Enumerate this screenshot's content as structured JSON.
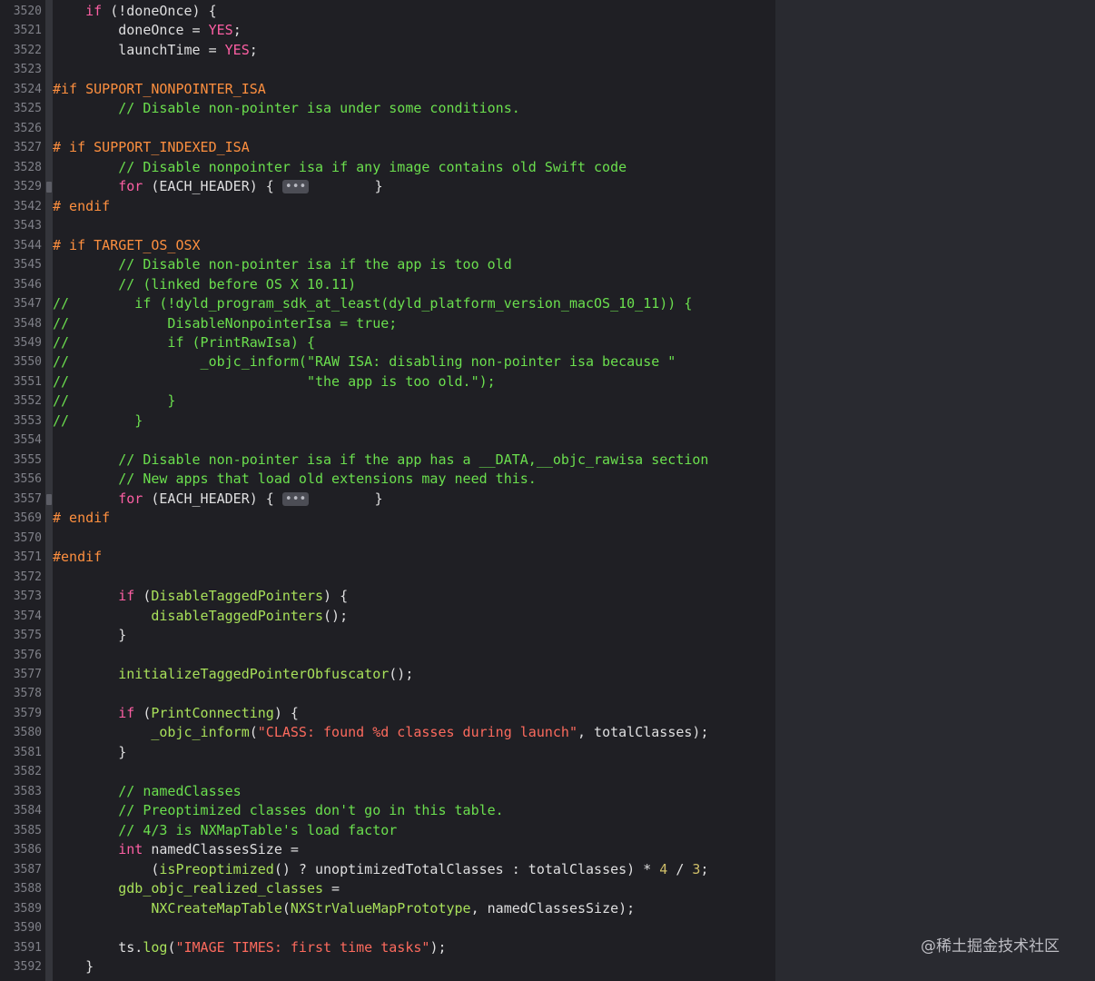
{
  "editor": {
    "lines": [
      {
        "n": "3520",
        "segs": [
          [
            "id",
            "    "
          ],
          [
            "kw",
            "if"
          ],
          [
            "id",
            " (!doneOnce) {"
          ]
        ]
      },
      {
        "n": "3521",
        "segs": [
          [
            "id",
            "        doneOnce = "
          ],
          [
            "kw",
            "YES"
          ],
          [
            "id",
            ";"
          ]
        ]
      },
      {
        "n": "3522",
        "segs": [
          [
            "id",
            "        launchTime = "
          ],
          [
            "kw",
            "YES"
          ],
          [
            "id",
            ";"
          ]
        ]
      },
      {
        "n": "3523",
        "segs": []
      },
      {
        "n": "3524",
        "segs": [
          [
            "pp",
            "#if SUPPORT_NONPOINTER_ISA"
          ]
        ]
      },
      {
        "n": "3525",
        "segs": [
          [
            "cm",
            "        // Disable non-pointer isa under some conditions."
          ]
        ]
      },
      {
        "n": "3526",
        "segs": []
      },
      {
        "n": "3527",
        "segs": [
          [
            "pp",
            "# if SUPPORT_INDEXED_ISA"
          ]
        ]
      },
      {
        "n": "3528",
        "segs": [
          [
            "cm",
            "        // Disable nonpointer isa if any image contains old Swift code"
          ]
        ]
      },
      {
        "n": "3529",
        "fold": true,
        "segs": [
          [
            "id",
            "        "
          ],
          [
            "kw",
            "for"
          ],
          [
            "id",
            " (EACH_HEADER) { "
          ],
          [
            "ellipsis",
            "•••"
          ],
          [
            "id",
            "        }"
          ]
        ]
      },
      {
        "n": "3542",
        "segs": [
          [
            "pp",
            "# endif"
          ]
        ]
      },
      {
        "n": "3543",
        "segs": []
      },
      {
        "n": "3544",
        "segs": [
          [
            "pp",
            "# if TARGET_OS_OSX"
          ]
        ]
      },
      {
        "n": "3545",
        "segs": [
          [
            "cm",
            "        // Disable non-pointer isa if the app is too old"
          ]
        ]
      },
      {
        "n": "3546",
        "segs": [
          [
            "cm",
            "        // (linked before OS X 10.11)"
          ]
        ]
      },
      {
        "n": "3547",
        "segs": [
          [
            "cm",
            "//        if (!dyld_program_sdk_at_least(dyld_platform_version_macOS_10_11)) {"
          ]
        ]
      },
      {
        "n": "3548",
        "segs": [
          [
            "cm",
            "//            DisableNonpointerIsa = true;"
          ]
        ]
      },
      {
        "n": "3549",
        "segs": [
          [
            "cm",
            "//            if (PrintRawIsa) {"
          ]
        ]
      },
      {
        "n": "3550",
        "segs": [
          [
            "cm",
            "//                _objc_inform(\"RAW ISA: disabling non-pointer isa because \""
          ]
        ]
      },
      {
        "n": "3551",
        "segs": [
          [
            "cm",
            "//                             \"the app is too old.\");"
          ]
        ]
      },
      {
        "n": "3552",
        "segs": [
          [
            "cm",
            "//            }"
          ]
        ]
      },
      {
        "n": "3553",
        "segs": [
          [
            "cm",
            "//        }"
          ]
        ]
      },
      {
        "n": "3554",
        "segs": []
      },
      {
        "n": "3555",
        "segs": [
          [
            "cm",
            "        // Disable non-pointer isa if the app has a __DATA,__objc_rawisa section"
          ]
        ]
      },
      {
        "n": "3556",
        "segs": [
          [
            "cm",
            "        // New apps that load old extensions may need this."
          ]
        ]
      },
      {
        "n": "3557",
        "fold": true,
        "segs": [
          [
            "id",
            "        "
          ],
          [
            "kw",
            "for"
          ],
          [
            "id",
            " (EACH_HEADER) { "
          ],
          [
            "ellipsis",
            "•••"
          ],
          [
            "id",
            "        }"
          ]
        ]
      },
      {
        "n": "3569",
        "segs": [
          [
            "pp",
            "# endif"
          ]
        ]
      },
      {
        "n": "3570",
        "segs": []
      },
      {
        "n": "3571",
        "segs": [
          [
            "pp",
            "#endif"
          ]
        ]
      },
      {
        "n": "3572",
        "segs": []
      },
      {
        "n": "3573",
        "segs": [
          [
            "id",
            "        "
          ],
          [
            "kw",
            "if"
          ],
          [
            "id",
            " ("
          ],
          [
            "fn",
            "DisableTaggedPointers"
          ],
          [
            "id",
            ") {"
          ]
        ]
      },
      {
        "n": "3574",
        "segs": [
          [
            "id",
            "            "
          ],
          [
            "fn",
            "disableTaggedPointers"
          ],
          [
            "id",
            "();"
          ]
        ]
      },
      {
        "n": "3575",
        "segs": [
          [
            "id",
            "        }"
          ]
        ]
      },
      {
        "n": "3576",
        "segs": []
      },
      {
        "n": "3577",
        "segs": [
          [
            "id",
            "        "
          ],
          [
            "fn",
            "initializeTaggedPointerObfuscator"
          ],
          [
            "id",
            "();"
          ]
        ]
      },
      {
        "n": "3578",
        "segs": []
      },
      {
        "n": "3579",
        "segs": [
          [
            "id",
            "        "
          ],
          [
            "kw",
            "if"
          ],
          [
            "id",
            " ("
          ],
          [
            "fn",
            "PrintConnecting"
          ],
          [
            "id",
            ") {"
          ]
        ]
      },
      {
        "n": "3580",
        "segs": [
          [
            "id",
            "            "
          ],
          [
            "fn",
            "_objc_inform"
          ],
          [
            "id",
            "("
          ],
          [
            "str",
            "\"CLASS: found %d classes during launch\""
          ],
          [
            "id",
            ", totalClasses);"
          ]
        ]
      },
      {
        "n": "3581",
        "segs": [
          [
            "id",
            "        }"
          ]
        ]
      },
      {
        "n": "3582",
        "segs": []
      },
      {
        "n": "3583",
        "segs": [
          [
            "cm",
            "        // namedClasses"
          ]
        ]
      },
      {
        "n": "3584",
        "segs": [
          [
            "cm",
            "        // Preoptimized classes don't go in this table."
          ]
        ]
      },
      {
        "n": "3585",
        "segs": [
          [
            "cm",
            "        // 4/3 is NXMapTable's load factor"
          ]
        ]
      },
      {
        "n": "3586",
        "segs": [
          [
            "id",
            "        "
          ],
          [
            "kw",
            "int"
          ],
          [
            "id",
            " namedClassesSize ="
          ]
        ]
      },
      {
        "n": "3587",
        "segs": [
          [
            "id",
            "            ("
          ],
          [
            "fn",
            "isPreoptimized"
          ],
          [
            "id",
            "() ? unoptimizedTotalClasses : totalClasses) * "
          ],
          [
            "num",
            "4"
          ],
          [
            "id",
            " / "
          ],
          [
            "num",
            "3"
          ],
          [
            "id",
            ";"
          ]
        ]
      },
      {
        "n": "3588",
        "segs": [
          [
            "fn",
            "        gdb_objc_realized_classes"
          ],
          [
            "id",
            " ="
          ]
        ]
      },
      {
        "n": "3589",
        "segs": [
          [
            "id",
            "            "
          ],
          [
            "fn",
            "NXCreateMapTable"
          ],
          [
            "id",
            "("
          ],
          [
            "fn",
            "NXStrValueMapPrototype"
          ],
          [
            "id",
            ", namedClassesSize);"
          ]
        ]
      },
      {
        "n": "3590",
        "segs": []
      },
      {
        "n": "3591",
        "segs": [
          [
            "id",
            "        ts."
          ],
          [
            "fn",
            "log"
          ],
          [
            "id",
            "("
          ],
          [
            "str",
            "\"IMAGE TIMES: first time tasks\""
          ],
          [
            "id",
            ");"
          ]
        ]
      },
      {
        "n": "3592",
        "segs": [
          [
            "id",
            "    }"
          ]
        ]
      }
    ]
  },
  "watermark": "@稀土掘金技术社区",
  "colors": {
    "keyword": "#fc5fa3",
    "preprocessor": "#fd8f3f",
    "comment": "#6bdf4e",
    "string": "#fc6a5d",
    "number": "#d0bf69",
    "function": "#a8e05a",
    "text": "#dfdfe0",
    "background": "#1f1f24"
  }
}
